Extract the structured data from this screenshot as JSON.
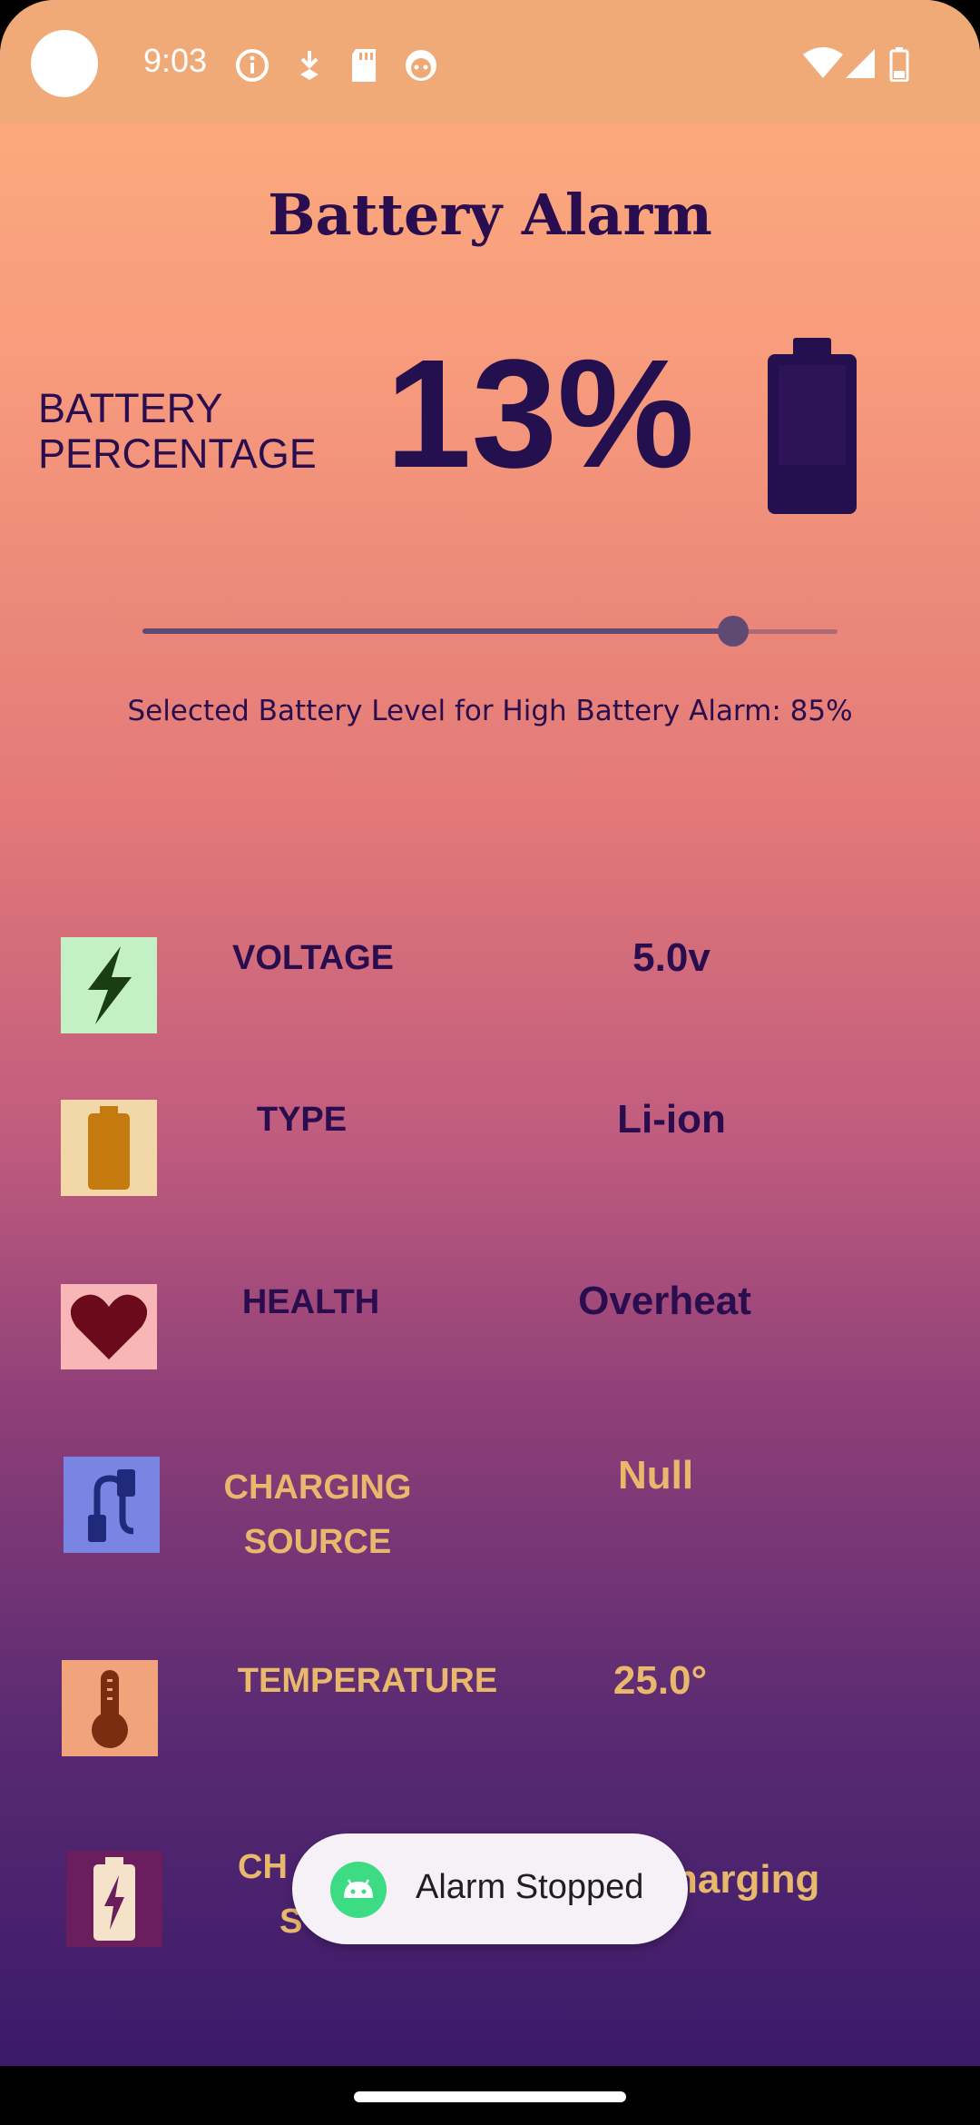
{
  "status_bar": {
    "time": "9:03"
  },
  "title": "Battery Alarm",
  "battery": {
    "label_line1": "BATTERY",
    "label_line2": "PERCENTAGE",
    "percentage": "13%"
  },
  "slider": {
    "value_fraction": 0.85
  },
  "selected_level_text": "Selected Battery Level for High Battery Alarm: 85%",
  "rows": {
    "voltage": {
      "label": "VOLTAGE",
      "value": "5.0v",
      "icon": "lightning-icon",
      "icon_bg": "#c4f0c6"
    },
    "type": {
      "label": "TYPE",
      "value": "Li-ion",
      "icon": "battery-icon",
      "icon_bg": "#f2d7a8"
    },
    "health": {
      "label": "HEALTH",
      "value": "Overheat",
      "icon": "heart-icon",
      "icon_bg": "#f9b6b6"
    },
    "charging_source": {
      "label_line1": "CHARGING",
      "label_line2": "SOURCE",
      "value": "Null",
      "icon": "cable-icon",
      "icon_bg": "#7a85e3"
    },
    "temperature": {
      "label": "TEMPERATURE",
      "value": "25.0°",
      "icon": "thermometer-icon",
      "icon_bg": "#f1a47c"
    },
    "charging_status": {
      "label_line1": "CH",
      "label_line2": "S",
      "value": "harging",
      "icon": "battery-charging-icon",
      "icon_bg": "#6a1e5d"
    }
  },
  "toast": {
    "text": "Alarm Stopped"
  },
  "colors": {
    "title": "#2a0d4e",
    "gold_text": "#e8b86c"
  }
}
